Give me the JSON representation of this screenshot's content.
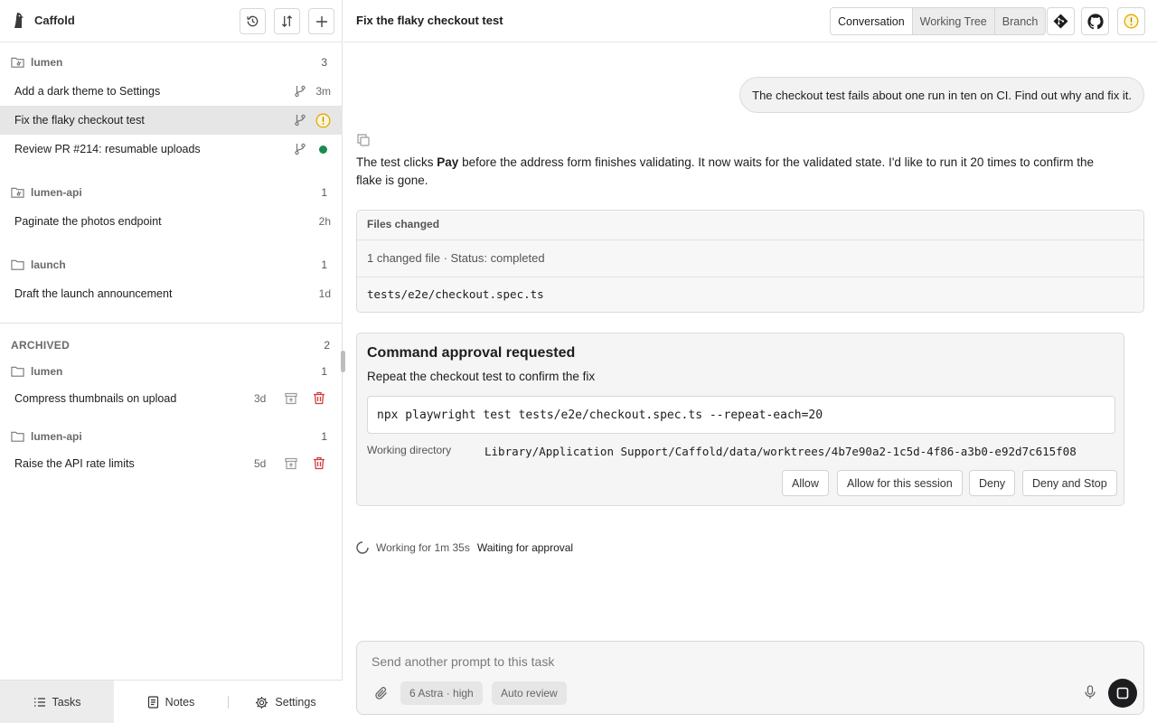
{
  "app": {
    "name": "Caffold"
  },
  "sidebar": {
    "groups": [
      {
        "name": "lumen",
        "count": "3",
        "tasks": [
          {
            "title": "Add a dark theme to Settings",
            "meta": "3m"
          },
          {
            "title": "Fix the flaky checkout test",
            "status": "needs-attention"
          },
          {
            "title": "Review PR #214: resumable uploads",
            "status": "running"
          }
        ]
      },
      {
        "name": "lumen-api",
        "count": "1",
        "tasks": [
          {
            "title": "Paginate the photos endpoint",
            "meta": "2h"
          }
        ]
      },
      {
        "name": "launch",
        "count": "1",
        "tasks": [
          {
            "title": "Draft the launch announcement",
            "meta": "1d"
          }
        ]
      }
    ],
    "archived": {
      "label": "ARCHIVED",
      "count": "2",
      "groups": [
        {
          "name": "lumen",
          "count": "1",
          "tasks": [
            {
              "title": "Compress thumbnails on upload",
              "age": "3d"
            }
          ]
        },
        {
          "name": "lumen-api",
          "count": "1",
          "tasks": [
            {
              "title": "Raise the API rate limits",
              "age": "5d"
            }
          ]
        }
      ]
    },
    "footer": {
      "tasks": "Tasks",
      "notes": "Notes",
      "settings": "Settings"
    }
  },
  "main": {
    "title": "Fix the flaky checkout test",
    "tabs": {
      "conversation": "Conversation",
      "working_tree": "Working Tree",
      "branch": "Branch"
    },
    "user_message": "The checkout test fails about one run in ten on CI. Find out why and fix it.",
    "assistant": {
      "before": "The test clicks ",
      "bold": "Pay",
      "after": " before the address form finishes validating. It now waits for the validated state. I'd like to run it 20 times to confirm the flake is gone."
    },
    "files_changed": {
      "title": "Files changed",
      "status": "1 changed file · Status: completed",
      "file": "tests/e2e/checkout.spec.ts"
    },
    "approval": {
      "title": "Command approval requested",
      "description": "Repeat the checkout test to confirm the fix",
      "command": "npx playwright test tests/e2e/checkout.spec.ts --repeat-each=20",
      "wd_label": "Working directory",
      "wd_value": "Library/Application Support/Caffold/data/worktrees/4b7e90a2-1c5d-4f86-a3b0-e92d7c615f08",
      "buttons": {
        "allow": "Allow",
        "allow_session": "Allow for this session",
        "deny": "Deny",
        "deny_stop": "Deny and Stop"
      }
    },
    "status": {
      "working": "Working for 1m 35s",
      "waiting": "Waiting for approval"
    },
    "composer": {
      "placeholder": "Send another prompt to this task",
      "model": "6 Astra",
      "effort": "· high",
      "review": "Auto review"
    }
  },
  "colors": {
    "running": "#1c8a4e",
    "warning": "#e0a800",
    "danger": "#d33c3c"
  }
}
